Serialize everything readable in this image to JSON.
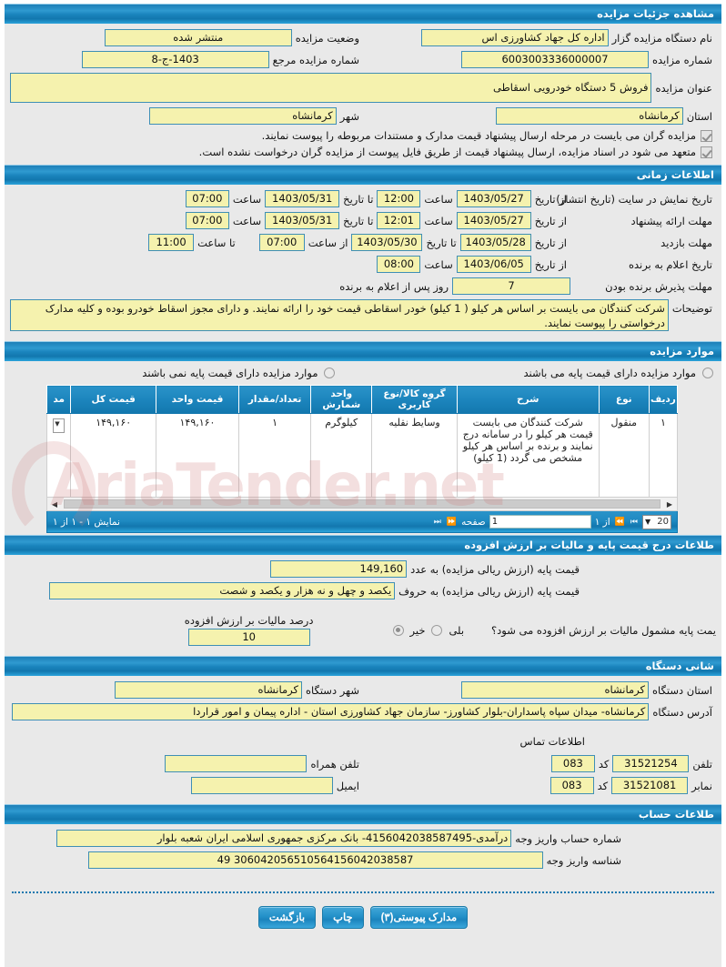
{
  "sections": {
    "details": {
      "title": "مشاهده جزئیات مزایده",
      "org_label": "نام دستگاه مزایده گزار",
      "org_value": "اداره کل جهاد کشاورزی اس",
      "status_label": "وضعیت مزایده",
      "status_value": "منتشر شده",
      "number_label": "شماره مزایده",
      "number_value": "6003003336000007",
      "ref_number_label": "شماره مزایده مرجع",
      "ref_number_value": "1403-ج-8",
      "subject_label": "عنوان مزایده",
      "subject_value": "فروش 5 دستگاه خودرویی اسقاطی",
      "province_label": "استان",
      "province_value": "کرمانشاه",
      "city_label": "شهر",
      "city_value": "کرمانشاه"
    },
    "notices": [
      "مزایده گران می بایست در مرحله ارسال پیشنهاد قیمت مدارک و مستندات مربوطه را پیوست نمایند.",
      "متعهد می شود در اسناد مزایده، ارسال پیشنهاد قیمت از طریق فایل پیوست از مزایده گران درخواست نشده است."
    ],
    "time": {
      "title": "اطلاعات زمانی",
      "rows": [
        {
          "label": "تاریخ نمایش در سایت (تاریخ انتشار)",
          "from_label": "از تاریخ",
          "from_value": "1403/05/27",
          "time1_label": "ساعت",
          "time1_value": "12:00",
          "to_label": "تا تاریخ",
          "to_value": "1403/05/31",
          "time2_label": "ساعت",
          "time2_value": "07:00"
        },
        {
          "label": "مهلت ارائه پیشنهاد",
          "from_label": "از تاریخ",
          "from_value": "1403/05/27",
          "time1_label": "ساعت",
          "time1_value": "12:01",
          "to_label": "تا تاریخ",
          "to_value": "1403/05/31",
          "time2_label": "ساعت",
          "time2_value": "07:00"
        },
        {
          "label": "مهلت بازدید",
          "from_label": "از تاریخ",
          "from_value": "1403/05/28",
          "to_label": "تا تاریخ",
          "to_value": "1403/05/30",
          "time1_label": "از ساعت",
          "time1_value": "07:00",
          "time2_label": "تا ساعت",
          "time2_value": "11:00"
        }
      ],
      "winner_label": "تاریخ اعلام به برنده",
      "winner_from_label": "از تاریخ",
      "winner_from_value": "1403/06/05",
      "winner_time_label": "ساعت",
      "winner_time_value": "08:00",
      "accept_label": "مهلت پذیرش برنده بودن",
      "accept_value": "7",
      "accept_suffix": "روز پس از اعلام به برنده",
      "notes_label": "توضیحات",
      "notes_value": "شرکت کنندگان می بایست بر  اساس هر کیلو ( 1 کیلو) خودر اسقاطی قیمت خود را ارائه نمایند. و دارای مجوز اسقاط خودرو بوده و کلیه مدارک درخواستی را پیوست نمایند."
    },
    "items": {
      "title": "موارد مزایده",
      "radio_with_base": "موارد مزایده دارای قیمت پایه می باشند",
      "radio_without_base": "موارد مزایده دارای قیمت پایه نمی باشند",
      "columns": [
        "ردیف",
        "نوع",
        "شرح",
        "گروه کالا/نوع کاربری",
        "واحد شمارش",
        "تعداد/مقدار",
        "قیمت واحد",
        "قیمت کل",
        "مد"
      ],
      "rows": [
        {
          "index": "۱",
          "type": "منقول",
          "desc": "شرکت کنندگان می بایست قیمت هر کیلو را در سامانه درج نمایند و برنده بر اساس هر کیلو مشخص می گردد (1 کیلو)",
          "group": "وسایط نقلیه",
          "unit": "کیلوگرم",
          "qty": "۱",
          "unit_price": "۱۴۹,۱۶۰",
          "total_price": "۱۴۹,۱۶۰"
        }
      ],
      "pager": {
        "showing": "نمایش ۱ - ۱ از ۱",
        "page_label": "صفحه",
        "page_value": "1",
        "of_label": "از ۱",
        "page_size": "20"
      }
    },
    "price": {
      "title": "طلاعات درج قیمت پایه و مالیات بر ارزش افزوده",
      "base_num_label": "قیمت پایه (ارزش ریالی مزایده) به عدد",
      "base_num_value": "149,160",
      "base_text_label": "قیمت پایه (ارزش ریالی مزایده) به حروف",
      "base_text_value": "یکصد و چهل و نه هزار و یکصد و شصت",
      "vat_question": "یمت پایه مشمول مالیات بر ارزش افزوده می شود؟",
      "vat_yes": "بلی",
      "vat_no": "خیر",
      "vat_selected": "خیر",
      "vat_percent_label": "درصد مالیات بر ارزش افزوده",
      "vat_percent_value": "10"
    },
    "address": {
      "title": "شانی دستگاه",
      "province_label": "استان دستگاه",
      "province_value": "کرمانشاه",
      "city_label": "شهر دستگاه",
      "city_value": "کرمانشاه",
      "addr_label": "آدرس دستگاه",
      "addr_value": "کرمانشاه- میدان سپاه پاسداران-بلوار کشاورز- سازمان جهاد کشاورزی استان - اداره پیمان و امور قراردا",
      "contact_title": "اطلاعات تماس",
      "phone_label": "تلفن",
      "phone_value": "31521254",
      "phone_code_label": "کد",
      "phone_code_value": "083",
      "mobile_label": "تلفن همراه",
      "mobile_value": "",
      "fax_label": "نمابر",
      "fax_value": "31521081",
      "fax_code_label": "کد",
      "fax_code_value": "083",
      "email_label": "ایمیل",
      "email_value": ""
    },
    "account": {
      "title": "طلاعات حساب",
      "acc_label": "شماره حساب واریز وجه",
      "acc_value": "درآمدی-4156042038587495- بانک مرکزی جمهوری اسلامی ایران شعبه بلوار",
      "sheba_label": "شناسه واریز وجه",
      "sheba_value": "306042056510564156042038587 49"
    }
  },
  "footer": {
    "attachments": "مدارک پیوستی(۳)",
    "print": "چاپ",
    "back": "بازگشت"
  },
  "colors": {
    "header_blue": "#1d7fb8",
    "field_yellow": "#f5f2ae",
    "field_border": "#3f8fb5",
    "page_bg": "#e9e9e9"
  }
}
